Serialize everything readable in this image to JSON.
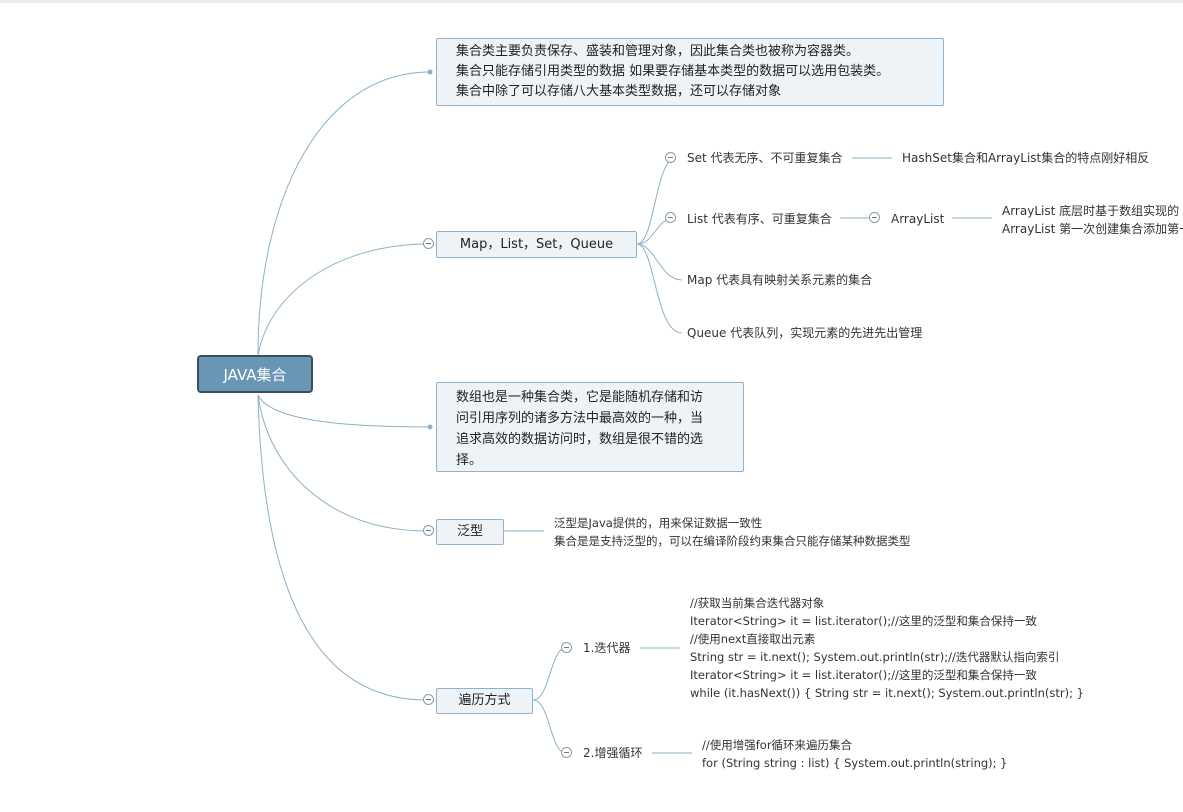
{
  "root": {
    "label": "JAVA集合"
  },
  "intro": {
    "lines": [
      "集合类主要负责保存、盛装和管理对象，因此集合类也被称为容器类。",
      "集合只能存储引用类型的数据 如果要存储基本类型的数据可以选用包装类。",
      "集合中除了可以存储八大基本类型数据，还可以存储对象"
    ]
  },
  "types": {
    "label": "Map，List，Set，Queue",
    "set": {
      "label": "Set 代表无序、不可重复集合",
      "note": "HashSet集合和ArrayList集合的特点刚好相反"
    },
    "list": {
      "label": "List 代表有序、可重复集合",
      "child": "ArrayList",
      "notes": [
        "ArrayList 底层时基于数组实现的",
        "ArrayList 第一次创建集合添加第一"
      ]
    },
    "map": {
      "label": "Map 代表具有映射关系元素的集合"
    },
    "queue": {
      "label": "Queue 代表队列，实现元素的先进先出管理"
    }
  },
  "array": {
    "lines": [
      "数组也是一种集合类，它是能随机存储和访",
      "问引用序列的诸多方法中最高效的一种，当",
      "追求高效的数据访问时，数组是很不错的选",
      "择。"
    ]
  },
  "generics": {
    "label": "泛型",
    "notes": [
      "泛型是Java提供的，用来保证数据一致性",
      "集合是是支持泛型的，可以在编译阶段约束集合只能存储某种数据类型"
    ]
  },
  "traversal": {
    "label": "遍历方式",
    "iterator": {
      "label": "1.迭代器",
      "code": [
        "//获取当前集合迭代器对象",
        "Iterator<String> it = list.iterator();//这里的泛型和集合保持一致",
        "//使用next直接取出元素",
        "String str = it.next(); System.out.println(str);//迭代器默认指向索引",
        "Iterator<String> it = list.iterator();//这里的泛型和集合保持一致",
        "while (it.hasNext()) { String str = it.next(); System.out.println(str); }"
      ]
    },
    "foreach": {
      "label": "2.增强循环",
      "code": [
        "//使用增强for循环来遍历集合",
        "for (String string : list) { System.out.println(string); }"
      ]
    }
  },
  "colors": {
    "link": "#8eb0c6",
    "root_fill": "#6a96b6",
    "root_border": "#3a4f61",
    "box_fill": "#eef3f7",
    "box_border": "#8fb3cc"
  }
}
